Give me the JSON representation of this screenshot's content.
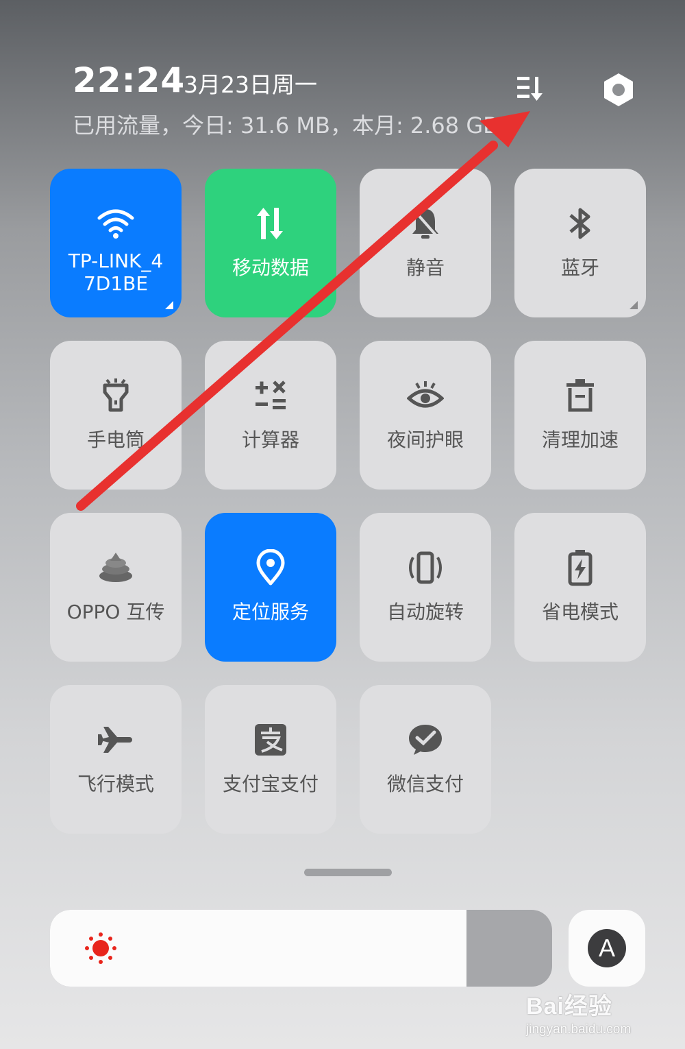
{
  "status": {
    "time": "22:24",
    "date": "3月23日周一",
    "data_usage": "已用流量，今日: 31.6 MB，本月: 2.68 GB"
  },
  "tiles": [
    {
      "label": "TP-LINK_4\n7D1BE",
      "icon": "wifi-icon",
      "state": "on"
    },
    {
      "label": "移动数据",
      "icon": "mobile-data-icon",
      "state": "on"
    },
    {
      "label": "静音",
      "icon": "bell-off-icon",
      "state": "off"
    },
    {
      "label": "蓝牙",
      "icon": "bluetooth-icon",
      "state": "off"
    },
    {
      "label": "手电筒",
      "icon": "flashlight-icon",
      "state": "off"
    },
    {
      "label": "计算器",
      "icon": "calculator-icon",
      "state": "off"
    },
    {
      "label": "夜间护眼",
      "icon": "eye-icon",
      "state": "off"
    },
    {
      "label": "清理加速",
      "icon": "trash-icon",
      "state": "off"
    },
    {
      "label": "OPPO 互传",
      "icon": "oppo-share-icon",
      "state": "off"
    },
    {
      "label": "定位服务",
      "icon": "location-pin-icon",
      "state": "on"
    },
    {
      "label": "自动旋转",
      "icon": "rotate-icon",
      "state": "off"
    },
    {
      "label": "省电模式",
      "icon": "battery-saver-icon",
      "state": "off"
    },
    {
      "label": "飞行模式",
      "icon": "airplane-icon",
      "state": "off"
    },
    {
      "label": "支付宝支付",
      "icon": "alipay-icon",
      "state": "off"
    },
    {
      "label": "微信支付",
      "icon": "wechat-pay-icon",
      "state": "off"
    }
  ],
  "brightness": {
    "level": 0.83,
    "auto_label": "A"
  },
  "colors": {
    "accent_blue": "#0a7cff",
    "accent_green": "#2ed27d",
    "arrow_red": "#e8312f",
    "sun_red": "#e8251c"
  },
  "watermark": {
    "logo": "Bai经验",
    "url": "jingyan.baidu.com"
  }
}
